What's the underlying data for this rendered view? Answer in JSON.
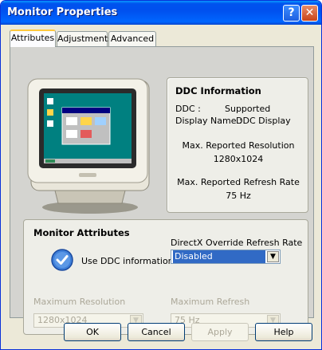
{
  "window": {
    "title": "Monitor Properties",
    "help_button": "?",
    "close_button": "✕"
  },
  "tabs": [
    {
      "label": "Attributes",
      "active": true
    },
    {
      "label": "Adjustments",
      "active": false
    },
    {
      "label": "Advanced",
      "active": false
    }
  ],
  "ddc_info": {
    "title": "DDC Information",
    "ddc_label": "DDC :",
    "ddc_value": "Supported",
    "display_name_label": "Display Name :",
    "display_name_value": "DDC Display",
    "max_resolution_label": "Max. Reported Resolution",
    "max_resolution_value": "1280x1024",
    "max_refresh_label": "Max. Reported Refresh Rate",
    "max_refresh_value": "75 Hz"
  },
  "monitor_attributes": {
    "title": "Monitor Attributes",
    "use_ddc_label": "Use DDC information",
    "use_ddc_checked": true,
    "directx_label": "DirectX Override Refresh Rate",
    "directx_value": "Disabled",
    "max_resolution_label": "Maximum Resolution",
    "max_resolution_value": "1280x1024",
    "max_refresh_label": "Maximum Refresh",
    "max_refresh_value": "75 Hz"
  },
  "buttons": {
    "ok": "OK",
    "cancel": "Cancel",
    "apply": "Apply",
    "help": "Help"
  },
  "colors": {
    "titlebar": "#0054e3",
    "face": "#ece9d8",
    "selection": "#316ac5"
  }
}
